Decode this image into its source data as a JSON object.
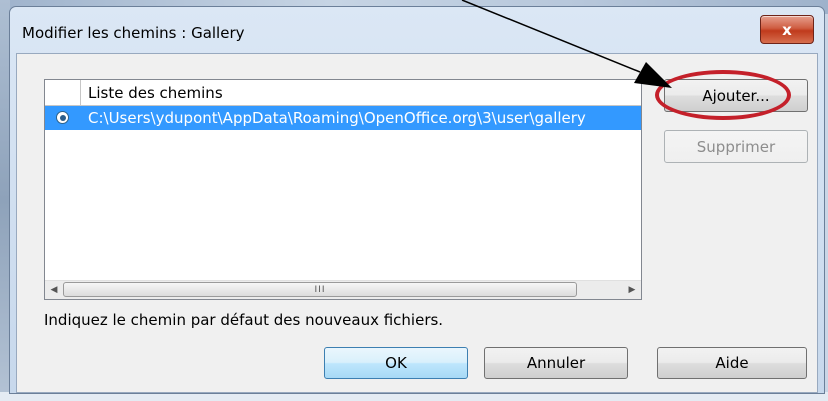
{
  "dialog": {
    "title": "Modifier les chemins : Gallery",
    "close_label": "x"
  },
  "list": {
    "header": "Liste des chemins",
    "rows": [
      {
        "path": "C:\\Users\\ydupont\\AppData\\Roaming\\OpenOffice.org\\3\\user\\gallery",
        "selected": true
      }
    ],
    "scroll_grip": "III"
  },
  "buttons": {
    "add_label": "Ajouter...",
    "remove_label": "Supprimer",
    "ok_label": "OK",
    "cancel_label": "Annuler",
    "help_label": "Aide"
  },
  "hint": "Indiquez le chemin par défaut des nouveaux fichiers.",
  "annotation": {
    "highlight_color": "#c4202a",
    "arrow_color": "#000000"
  },
  "colors": {
    "selection": "#3399ff"
  }
}
